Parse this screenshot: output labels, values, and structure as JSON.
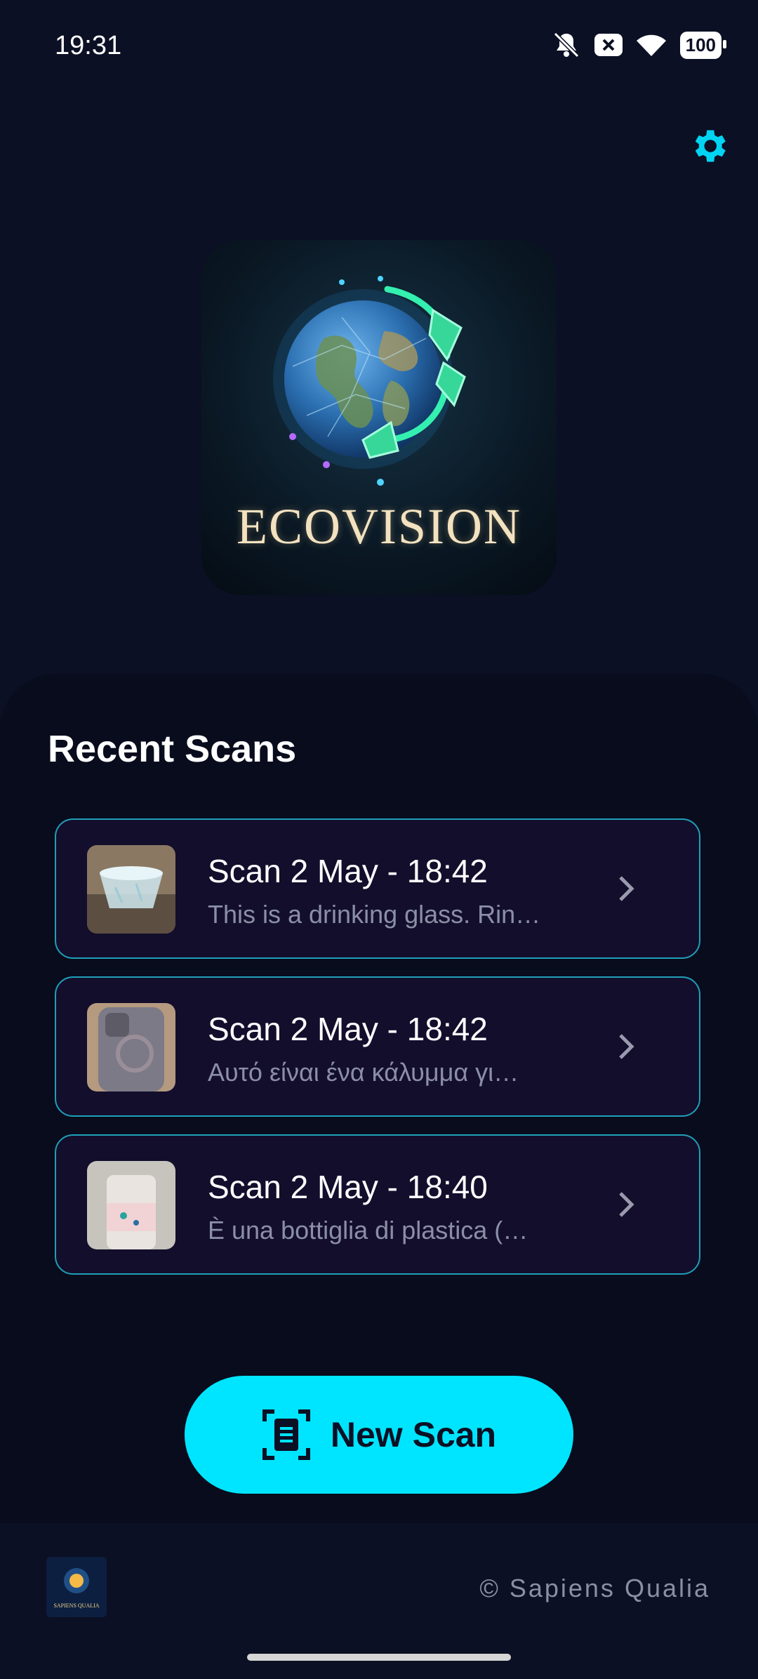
{
  "status_bar": {
    "time": "19:31",
    "battery": "100"
  },
  "header": {
    "settings_icon": "gear-icon",
    "accent": "#00e5ff"
  },
  "logo": {
    "title": "ECOVISION"
  },
  "recent": {
    "title": "Recent Scans",
    "items": [
      {
        "title": "Scan 2 May - 18:42",
        "subtitle": "This is a drinking glass. Rin…",
        "thumb": "glass-cup"
      },
      {
        "title": "Scan 2 May - 18:42",
        "subtitle": "Αυτό είναι ένα κάλυμμα γι…",
        "thumb": "phone-case"
      },
      {
        "title": "Scan 2 May - 18:40",
        "subtitle": "È una bottiglia di plastica (…",
        "thumb": "plastic-bottle"
      }
    ]
  },
  "actions": {
    "new_scan_label": "New Scan"
  },
  "footer": {
    "copyright": "© Sapiens Qualia",
    "logo_text": "SAPIENS QUALIA"
  }
}
